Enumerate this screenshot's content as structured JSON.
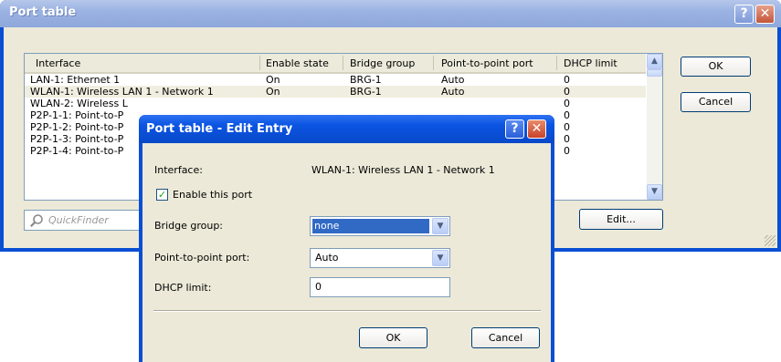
{
  "window": {
    "title": "Port table",
    "help_glyph": "?",
    "close_glyph": "✕"
  },
  "list": {
    "columns": [
      "Interface",
      "Enable state",
      "Bridge group",
      "Point-to-point port",
      "DHCP limit"
    ],
    "rows": [
      {
        "interface": "LAN-1: Ethernet 1",
        "enable": "On",
        "bridge": "BRG-1",
        "p2p": "Auto",
        "dhcp": "0"
      },
      {
        "interface": "WLAN-1: Wireless LAN 1 - Network 1",
        "enable": "On",
        "bridge": "BRG-1",
        "p2p": "Auto",
        "dhcp": "0"
      },
      {
        "interface": "WLAN-2: Wireless L",
        "enable": "",
        "bridge": "",
        "p2p": "",
        "dhcp": "0"
      },
      {
        "interface": "P2P-1-1: Point-to-P",
        "enable": "",
        "bridge": "",
        "p2p": "",
        "dhcp": "0"
      },
      {
        "interface": "P2P-1-2: Point-to-P",
        "enable": "",
        "bridge": "",
        "p2p": "",
        "dhcp": "0"
      },
      {
        "interface": "P2P-1-3: Point-to-P",
        "enable": "",
        "bridge": "",
        "p2p": "",
        "dhcp": "0"
      },
      {
        "interface": "P2P-1-4: Point-to-P",
        "enable": "",
        "bridge": "",
        "p2p": "",
        "dhcp": "0"
      }
    ]
  },
  "buttons": {
    "ok": "OK",
    "cancel": "Cancel",
    "edit": "Edit..."
  },
  "quickfinder": {
    "placeholder": "QuickFinder"
  },
  "dialog": {
    "title": "Port table - Edit Entry",
    "help_glyph": "?",
    "close_glyph": "✕",
    "interface_label": "Interface:",
    "interface_value": "WLAN-1: Wireless LAN 1 - Network 1",
    "enable_label": "Enable this port",
    "enable_checked": true,
    "bridge_label": "Bridge group:",
    "bridge_value": "none",
    "p2p_label": "Point-to-point port:",
    "p2p_value": "Auto",
    "dhcp_label": "DHCP limit:",
    "dhcp_value": "0",
    "ok": "OK",
    "cancel": "Cancel"
  },
  "colors": {
    "titlebar_inactive": "#9bb3e2",
    "titlebar_active": "#0b55e3",
    "selection": "#316ac5"
  }
}
